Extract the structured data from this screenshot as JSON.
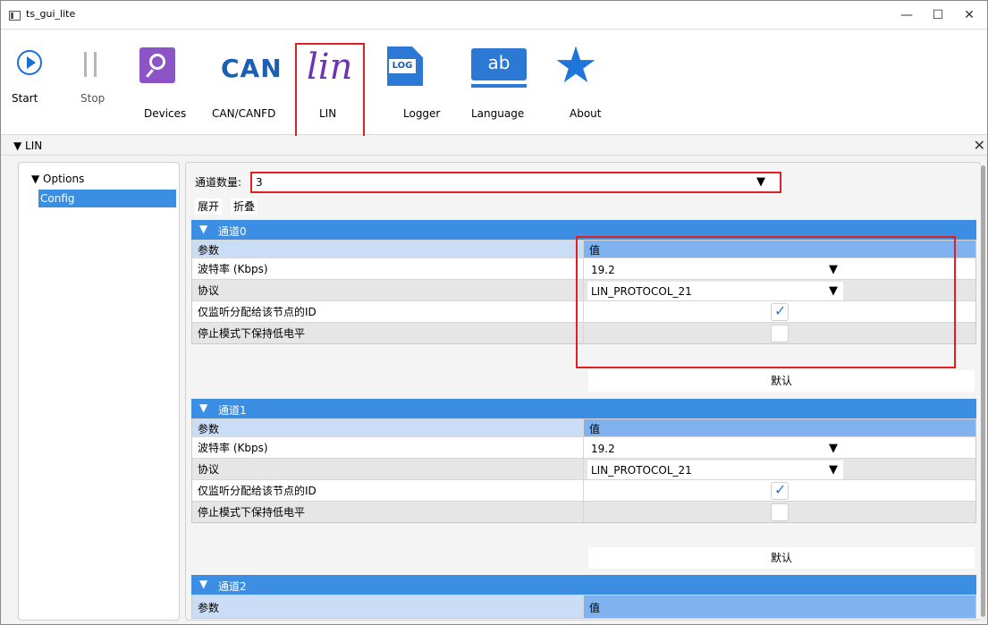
{
  "window": {
    "title": "ts_gui_lite",
    "minimize": "—",
    "maximize": "☐",
    "close": "✕"
  },
  "toolbar": {
    "start_label": "Start",
    "stop_label": "Stop",
    "devices_label": "Devices",
    "can_label": "CAN/CANFD",
    "can_icon_text": "CAN",
    "lin_label": "LIN",
    "lin_icon_text": "lin",
    "logger_label": "Logger",
    "logger_icon_text": "LOG",
    "language_label": "Language",
    "language_icon_text": "ab",
    "about_label": "About",
    "about_icon_text": "★"
  },
  "dock": {
    "title": "▼ LIN",
    "close": "✕"
  },
  "tree": {
    "root": "▼ Options",
    "selected": "Config"
  },
  "config": {
    "channel_count_label": "通道数量:",
    "channel_count_value": "3",
    "expand_label": "展开",
    "collapse_label": "折叠",
    "dropdown_arrow": "▼",
    "channels": [
      {
        "title": "通道0",
        "header_param": "参数",
        "header_value": "值",
        "baud_label": "波特率 (Kbps)",
        "baud_value": "19.2",
        "protocol_label": "协议",
        "protocol_value": "LIN_PROTOCOL_21",
        "listen_label": "仅监听分配给该节点的ID",
        "listen_checked": true,
        "stop_low_label": "停止模式下保持低电平",
        "stop_low_checked": false,
        "default_label": "默认"
      },
      {
        "title": "通道1",
        "header_param": "参数",
        "header_value": "值",
        "baud_label": "波特率 (Kbps)",
        "baud_value": "19.2",
        "protocol_label": "协议",
        "protocol_value": "LIN_PROTOCOL_21",
        "listen_label": "仅监听分配给该节点的ID",
        "listen_checked": true,
        "stop_low_label": "停止模式下保持低电平",
        "stop_low_checked": false,
        "default_label": "默认"
      },
      {
        "title": "通道2",
        "header_param": "参数",
        "header_value": "值"
      }
    ]
  },
  "colors": {
    "accent": "#3b8ee2",
    "highlight": "#e02020",
    "header_row": "#c9ddf7",
    "header_value": "#7fb2ee"
  }
}
